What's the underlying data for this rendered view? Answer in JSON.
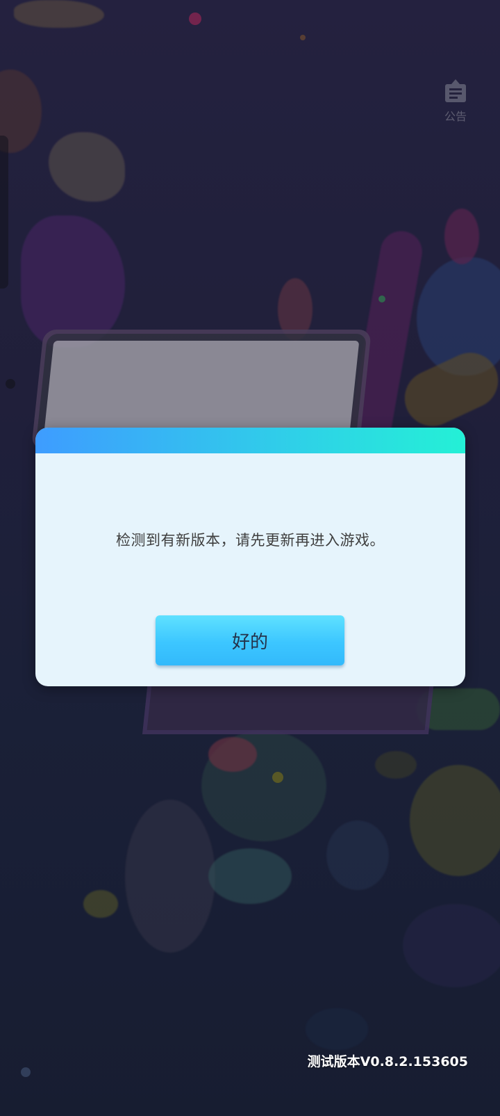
{
  "notice": {
    "icon": "notice-board-icon",
    "label": "公告"
  },
  "dialog": {
    "message": "检测到有新版本，请先更新再进入游戏。",
    "confirm_label": "好的",
    "header_gradient": [
      "#3e9cff",
      "#24f0d6"
    ],
    "button_color": "#3cc6ff"
  },
  "footer": {
    "version": "测试版本V0.8.2.153605"
  }
}
